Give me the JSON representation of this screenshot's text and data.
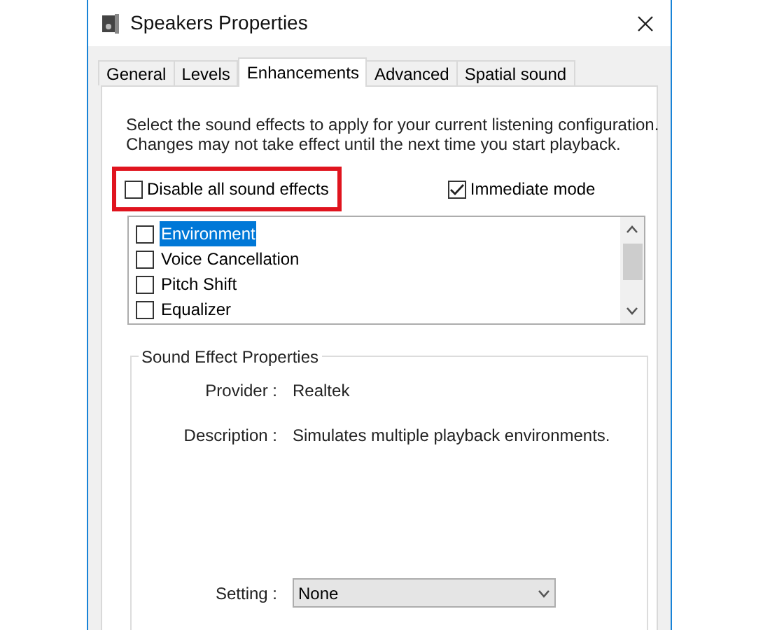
{
  "window": {
    "title": "Speakers Properties"
  },
  "tabs": [
    {
      "label": "General",
      "selected": false
    },
    {
      "label": "Levels",
      "selected": false
    },
    {
      "label": "Enhancements",
      "selected": true
    },
    {
      "label": "Advanced",
      "selected": false
    },
    {
      "label": "Spatial sound",
      "selected": false
    }
  ],
  "description": "Select the sound effects to apply for your current listening configuration. Changes may not take effect until the next time you start playback.",
  "options": [
    {
      "label": "Disable all sound effects",
      "checked": false,
      "highlighted": true
    },
    {
      "label": "Immediate mode",
      "checked": true,
      "highlighted": false
    }
  ],
  "effects": [
    {
      "label": "Environment",
      "checked": false,
      "selected": true
    },
    {
      "label": "Voice Cancellation",
      "checked": false,
      "selected": false
    },
    {
      "label": "Pitch Shift",
      "checked": false,
      "selected": false
    },
    {
      "label": "Equalizer",
      "checked": false,
      "selected": false
    }
  ],
  "properties": {
    "title": "Sound Effect Properties",
    "fields": [
      {
        "label": "Provider :",
        "value": "Realtek"
      },
      {
        "label": "Description :",
        "value": "Simulates multiple playback environments."
      }
    ],
    "setting": {
      "label": "Setting :",
      "value": "None"
    }
  }
}
